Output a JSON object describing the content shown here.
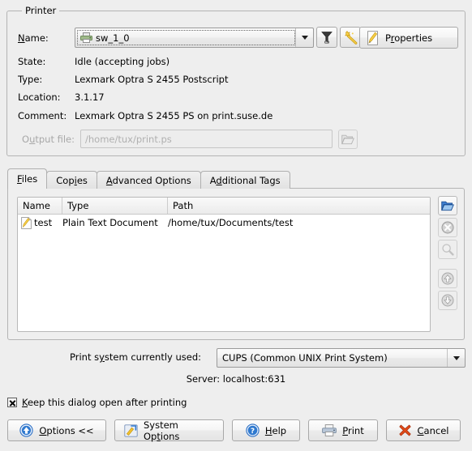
{
  "printer_group": {
    "title": "Printer",
    "name_label": "Name:",
    "name_label_mnemonic": "N",
    "name_value": "sw_1_0",
    "state_label": "State:",
    "state_value": "Idle (accepting jobs)",
    "type_label": "Type:",
    "type_value": "Lexmark Optra S 2455 Postscript",
    "location_label": "Location:",
    "location_value": "3.1.17",
    "comment_label": "Comment:",
    "comment_value": "Lexmark Optra S 2455 PS on print.suse.de",
    "output_file_label": "Output file:",
    "output_file_placeholder": "/home/tux/print.ps",
    "output_file_value": "",
    "properties_label": "Properties",
    "filter_button_title": "Filter",
    "wizard_button_title": "Add printer wizard",
    "browse_output_title": "Browse output file"
  },
  "tabs": [
    {
      "label": "Files",
      "mnemonic": "F",
      "active": true
    },
    {
      "label": "Copies",
      "mnemonic": "i",
      "active": false
    },
    {
      "label": "Advanced Options",
      "mnemonic": "A",
      "active": false
    },
    {
      "label": "Additional Tags",
      "mnemonic": "d",
      "active": false
    }
  ],
  "files_tab": {
    "columns": [
      "Name",
      "Type",
      "Path"
    ],
    "rows": [
      {
        "name": "test",
        "type": "Plain Text Document",
        "path": "/home/tux/Documents/test"
      }
    ],
    "side_buttons": [
      {
        "name": "add-file-button",
        "icon": "open-folder-icon",
        "enabled": true
      },
      {
        "name": "remove-file-button",
        "icon": "remove-circle-icon",
        "enabled": false
      },
      {
        "name": "preview-file-button",
        "icon": "magnifier-icon",
        "enabled": false
      },
      {
        "name": "move-up-button",
        "icon": "arrow-up-circle-icon",
        "enabled": false
      },
      {
        "name": "move-down-button",
        "icon": "arrow-down-circle-icon",
        "enabled": false
      }
    ]
  },
  "print_system": {
    "label": "Print system currently used:",
    "label_mnemonic": "y",
    "value": "CUPS (Common UNIX Print System)",
    "server_line": "Server: localhost:631"
  },
  "keep_open": {
    "label": "Keep this dialog open after printing",
    "mnemonic": "K",
    "checked": true
  },
  "bottom_buttons": [
    {
      "label": "Options <<",
      "mnemonic": "O",
      "icon": "arrow-up-circle-blue-icon"
    },
    {
      "label": "System Options",
      "mnemonic": "t",
      "icon": "system-options-icon"
    },
    {
      "label": "Help",
      "mnemonic": "H",
      "icon": "help-circle-icon"
    },
    {
      "label": "Print",
      "mnemonic": "P",
      "icon": "printer-icon"
    },
    {
      "label": "Cancel",
      "mnemonic": "C",
      "icon": "cancel-x-icon"
    }
  ],
  "colors": {
    "window_bg": "#eeeeee",
    "frame_border": "#b4b4b4",
    "list_bg": "#ffffff",
    "disabled_text": "#a8a8a8",
    "accent_blue": "#2a6ec4",
    "cancel_red": "#d8421a",
    "wand_yellow": "#f2c230"
  }
}
